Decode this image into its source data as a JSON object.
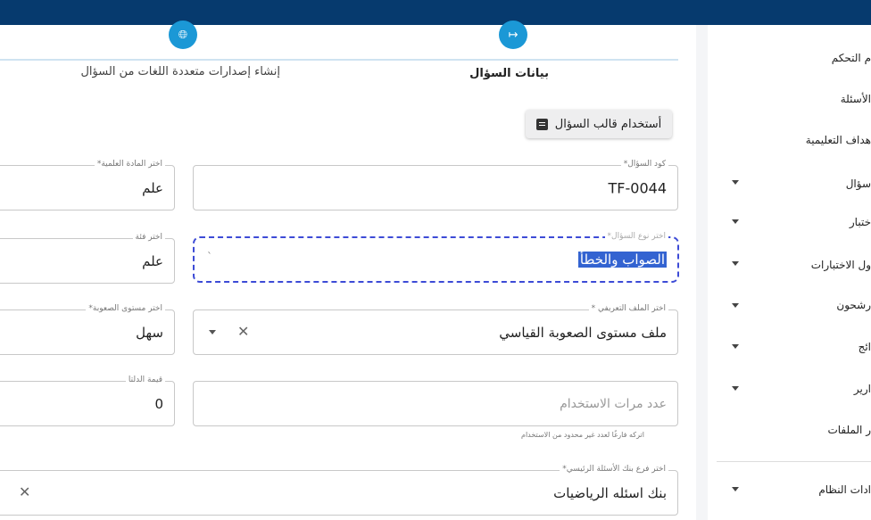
{
  "stepper": {
    "steps": [
      {
        "label": "بيانات السؤال",
        "icon": "arrow-right-to-bar-icon",
        "active": true
      },
      {
        "label": "إنشاء إصدارات متعددة اللغات من السؤال",
        "icon": "globe-icon",
        "active": false
      }
    ]
  },
  "template_button": {
    "label": "أستخدام قالب السؤال",
    "icon": "document-icon"
  },
  "form": {
    "question_code": {
      "label": "كود السؤال*",
      "value": "TF-0044"
    },
    "subject": {
      "label": "اختر المادة العلمية*",
      "value": "علم"
    },
    "question_type": {
      "label": "اختر نوع السؤال*",
      "value": "الصواب والخطأ"
    },
    "category": {
      "label": "اختر فئة",
      "value": "علم"
    },
    "definition_file": {
      "label": "اختر الملف التعريفي *",
      "value": "ملف مستوى الصعوبة القياسي"
    },
    "difficulty": {
      "label": "اختر مستوى الصعوبة*",
      "value": "سهل"
    },
    "usage_count": {
      "placeholder": "عدد مرات الاستخدام",
      "helper": "اتركه فارغًا لعدد غير محدود من الاستخدام"
    },
    "delta": {
      "label": "قيمة الدلتا",
      "value": "0"
    },
    "bank_branch": {
      "label": "اختر فرع بنك الأسئلة الرئيسي*",
      "value": "بنك اسئله الرياضيات"
    }
  },
  "sidebar": {
    "items": [
      {
        "label": "لوحة التحكم",
        "visible": "م التحكم",
        "has_arrow": false
      },
      {
        "label": "الأسئلة",
        "visible": "الأسئلة",
        "has_arrow": false
      },
      {
        "label": "الأهداف التعليمية",
        "visible": "هداف التعليمية",
        "has_arrow": false
      },
      {
        "label": "السؤال",
        "visible": "سؤال",
        "has_arrow": true
      },
      {
        "label": "الاختبار",
        "visible": "ختبار",
        "has_arrow": true
      },
      {
        "label": "جدول الاختبارات",
        "visible": "ول الاختبارات",
        "has_arrow": true
      },
      {
        "label": "المرشحون",
        "visible": "رشحون",
        "has_arrow": true
      },
      {
        "label": "النتائج",
        "visible": "ائج",
        "has_arrow": true
      },
      {
        "label": "التقارير",
        "visible": "ارير",
        "has_arrow": true
      },
      {
        "label": "مدير الملفات",
        "visible": "ر الملفات",
        "has_arrow": false
      },
      {
        "label": "إعدادات النظام",
        "visible": "ادات النظام",
        "has_arrow": true
      }
    ]
  },
  "colors": {
    "topbar": "#063a6e",
    "accent": "#1b98d6",
    "focus": "#3d4bd6",
    "selection": "#3363d1"
  }
}
